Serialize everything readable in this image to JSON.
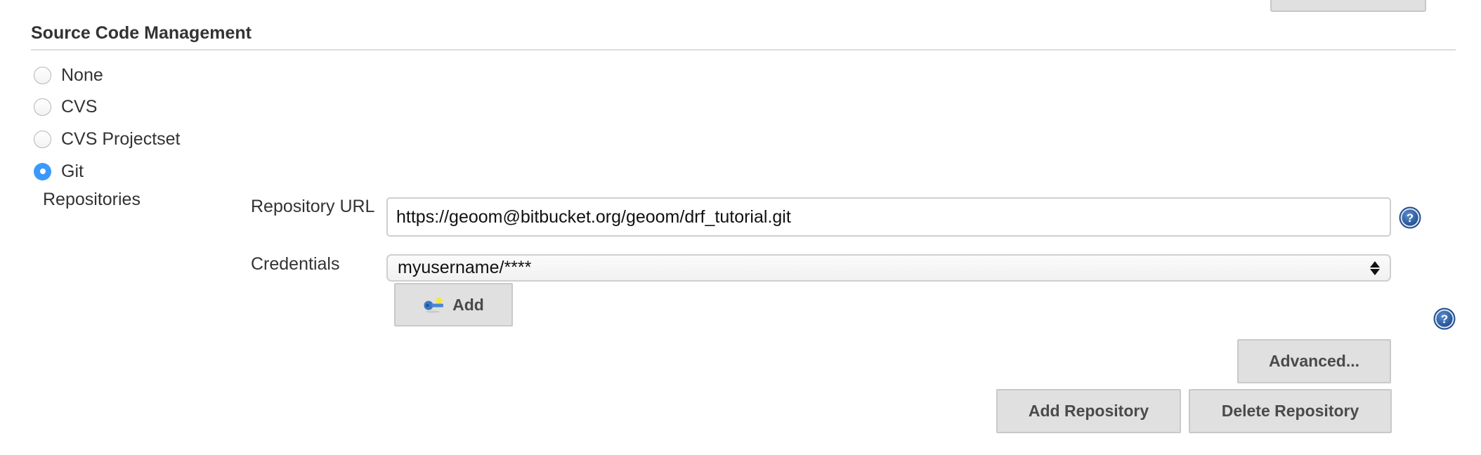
{
  "section": {
    "title": "Source Code Management"
  },
  "scm_options": [
    {
      "label": "None",
      "selected": false
    },
    {
      "label": "CVS",
      "selected": false
    },
    {
      "label": "CVS Projectset",
      "selected": false
    },
    {
      "label": "Git",
      "selected": true
    }
  ],
  "git": {
    "repositories_label": "Repositories",
    "repository_url_label": "Repository URL",
    "repository_url_value": "https://geoom@bitbucket.org/geoom/drf_tutorial.git",
    "credentials_label": "Credentials",
    "credentials_selected": "myusername/****",
    "add_credentials_label": "Add",
    "advanced_label": "Advanced...",
    "add_repository_label": "Add Repository",
    "delete_repository_label": "Delete Repository"
  },
  "icons": {
    "help": "help-icon",
    "key": "key-icon",
    "select_arrows": "select-arrows-icon"
  },
  "colors": {
    "radio_selected": "#3b99fc",
    "button_bg": "#e0e0e0",
    "help_icon": "#2a5a9a"
  }
}
